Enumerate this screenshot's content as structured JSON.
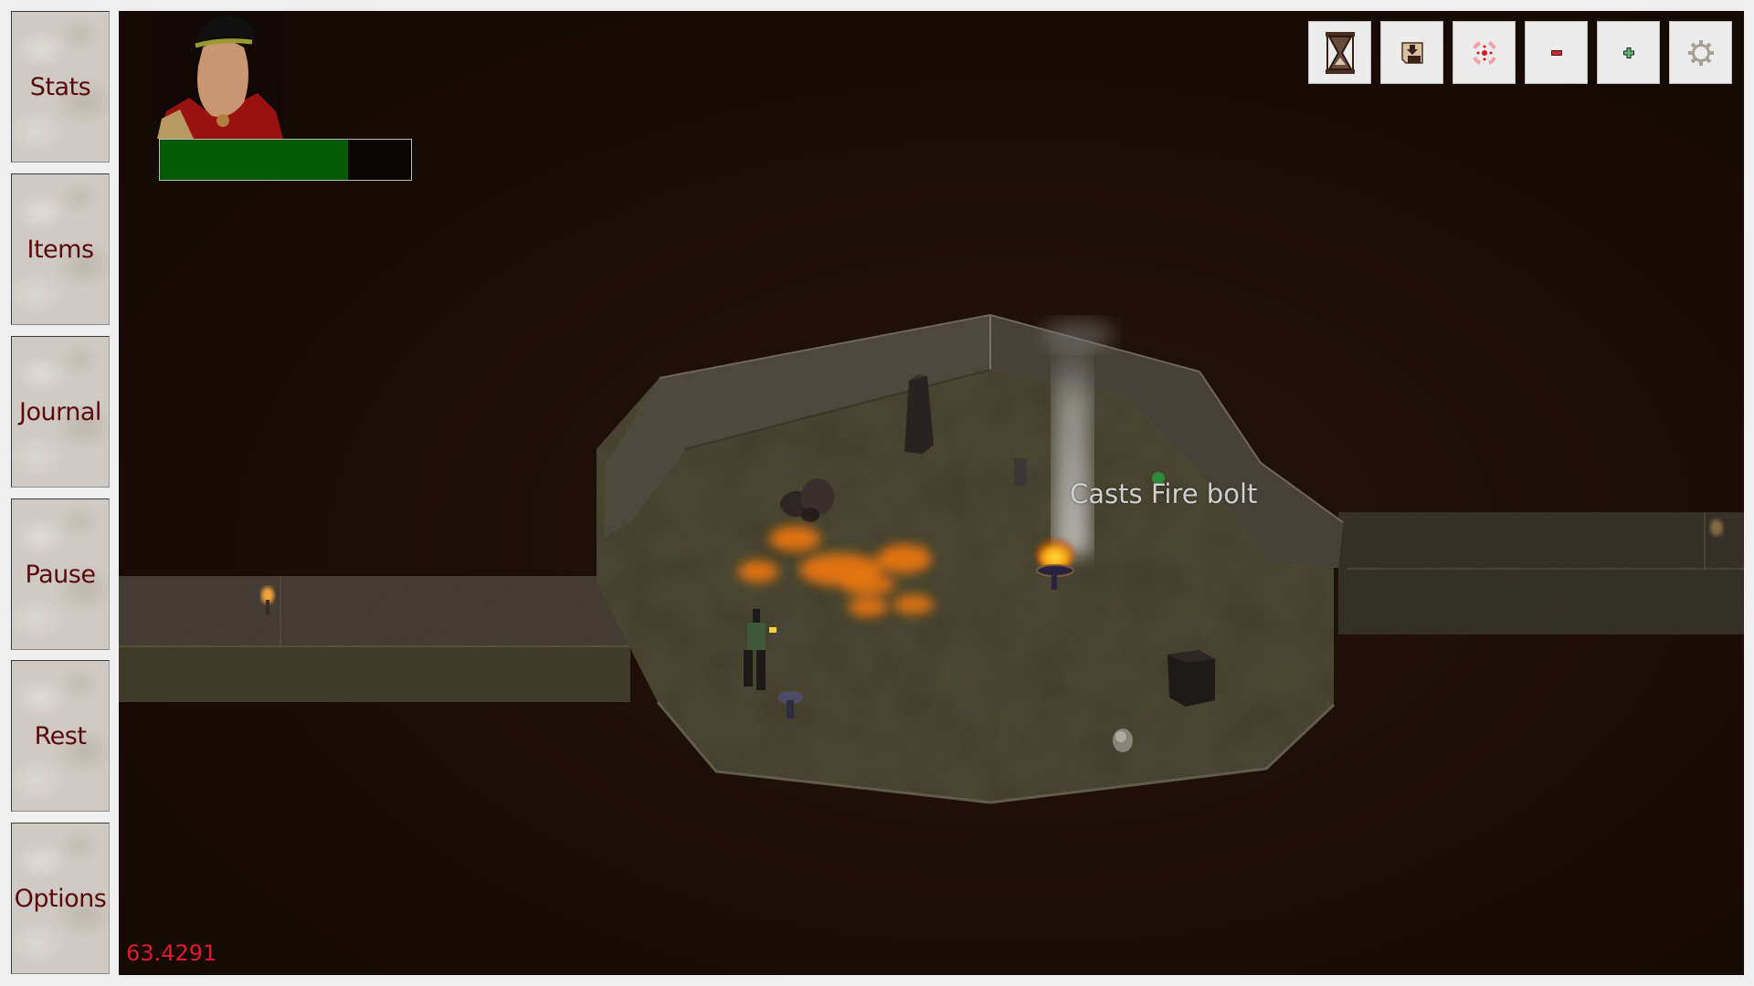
{
  "sidebar": {
    "buttons": [
      {
        "id": "stats",
        "label": "Stats"
      },
      {
        "id": "items",
        "label": "Items"
      },
      {
        "id": "journal",
        "label": "Journal"
      },
      {
        "id": "pause",
        "label": "Pause"
      },
      {
        "id": "rest",
        "label": "Rest"
      },
      {
        "id": "options",
        "label": "Options"
      }
    ]
  },
  "player": {
    "portrait": "hero-portrait",
    "health_fraction": 0.75,
    "health_color": "#055a05"
  },
  "toolbar": {
    "buttons": [
      {
        "id": "wait",
        "icon": "hourglass-icon"
      },
      {
        "id": "save",
        "icon": "save-icon"
      },
      {
        "id": "center",
        "icon": "crosshair-icon"
      },
      {
        "id": "zoom-out",
        "icon": "minus-icon"
      },
      {
        "id": "zoom-in",
        "icon": "plus-icon"
      },
      {
        "id": "settings",
        "icon": "gear-icon"
      }
    ]
  },
  "combat": {
    "floating_text": "Casts Fire bolt"
  },
  "debug": {
    "fps": "63.4291",
    "fps_color": "#e01a2a"
  },
  "colors": {
    "button_text": "#5a0a0a",
    "void": "#1b0e05"
  }
}
